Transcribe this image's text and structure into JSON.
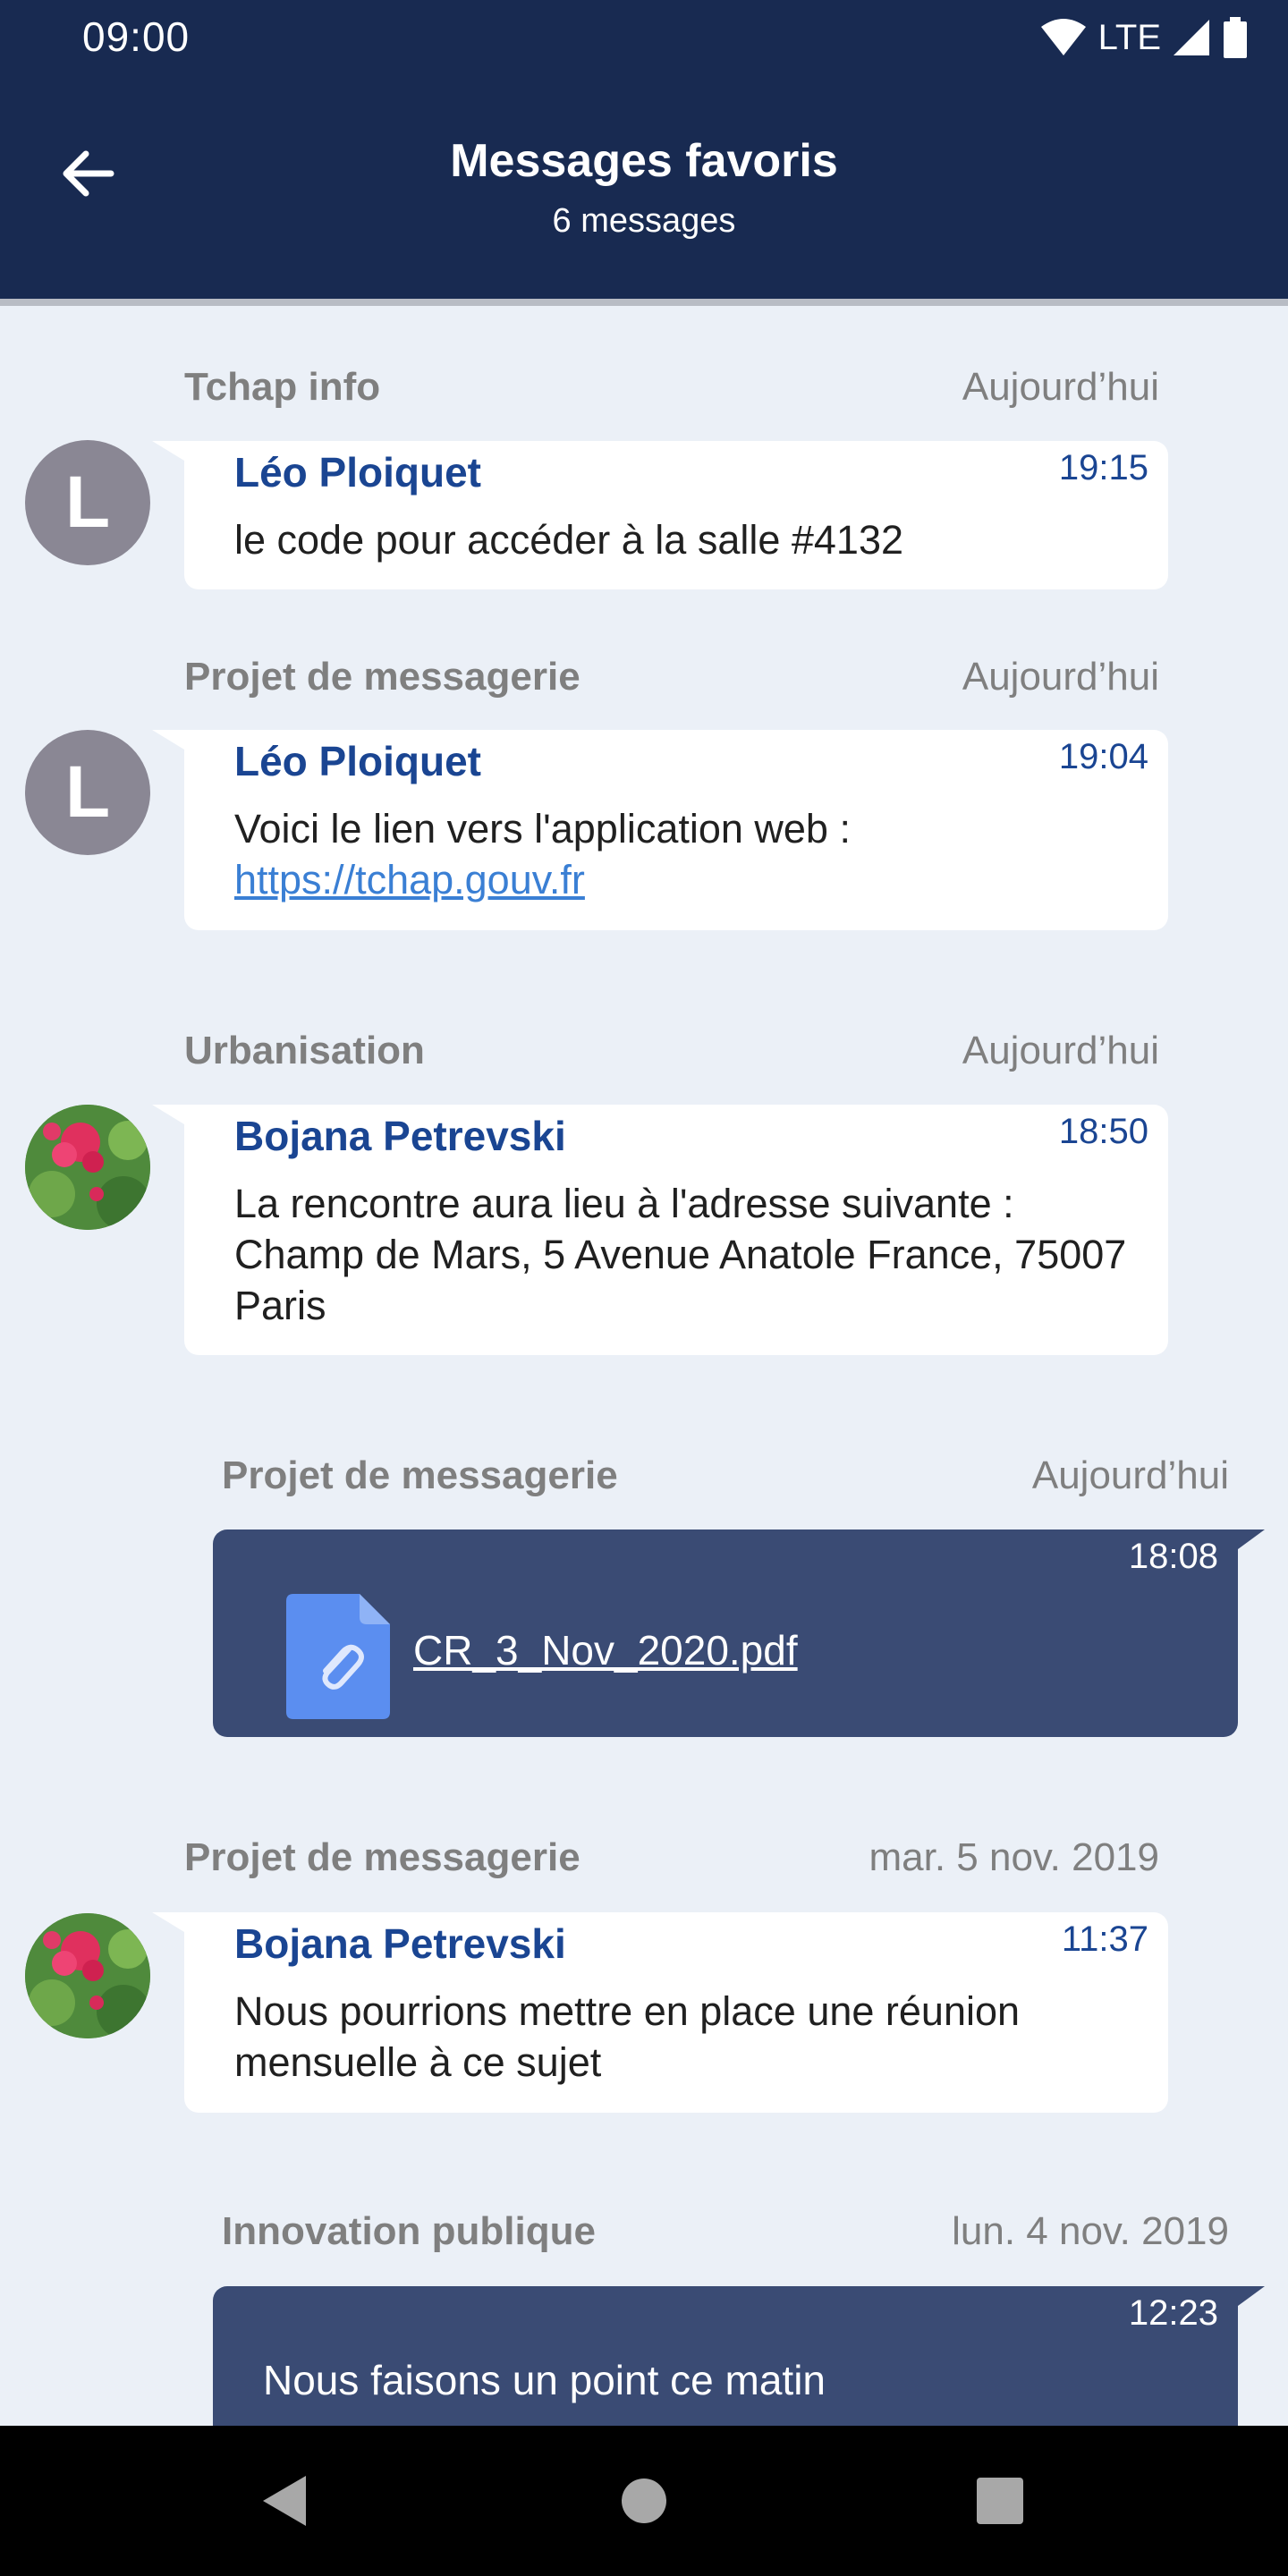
{
  "status": {
    "time": "09:00",
    "network": "LTE"
  },
  "header": {
    "title": "Messages favoris",
    "subtitle": "6 messages"
  },
  "messages": [
    {
      "room": "Tchap info",
      "date": "Aujourd’hui",
      "direction": "incoming",
      "sender": "Léo Ploiquet",
      "avatar_letter": "L",
      "time": "19:15",
      "text": "le code pour accéder à la salle #4132"
    },
    {
      "room": "Projet de messagerie",
      "date": "Aujourd’hui",
      "direction": "incoming",
      "sender": "Léo Ploiquet",
      "avatar_letter": "L",
      "time": "19:04",
      "text": "Voici le lien vers l'application web :",
      "link": "https://tchap.gouv.fr"
    },
    {
      "room": "Urbanisation",
      "date": "Aujourd’hui",
      "direction": "incoming",
      "sender": "Bojana Petrevski",
      "avatar": "flower-photo",
      "time": "18:50",
      "text": "La rencontre aura lieu à l'adresse suivante : Champ de Mars, 5 Avenue Anatole France, 75007 Paris"
    },
    {
      "room": "Projet de messagerie",
      "date": "Aujourd’hui",
      "direction": "outgoing",
      "time": "18:08",
      "file_name": "CR_3_Nov_2020.pdf",
      "file_icon": "paperclip-file-icon"
    },
    {
      "room": "Projet de messagerie",
      "date": "mar. 5 nov. 2019",
      "direction": "incoming",
      "sender": "Bojana Petrevski",
      "avatar": "flower-photo",
      "time": "11:37",
      "text": "Nous pourrions mettre en place une réunion mensuelle à ce sujet"
    },
    {
      "room": "Innovation publique",
      "date": "lun. 4 nov. 2019",
      "direction": "outgoing",
      "time": "12:23",
      "text": "Nous faisons un point ce matin"
    }
  ],
  "colors": {
    "header_bg": "#182a51",
    "page_bg": "#ebf0f7",
    "sender": "#1a4592",
    "outgoing_bubble": "#3a4b74",
    "link": "#3a7fd4"
  }
}
